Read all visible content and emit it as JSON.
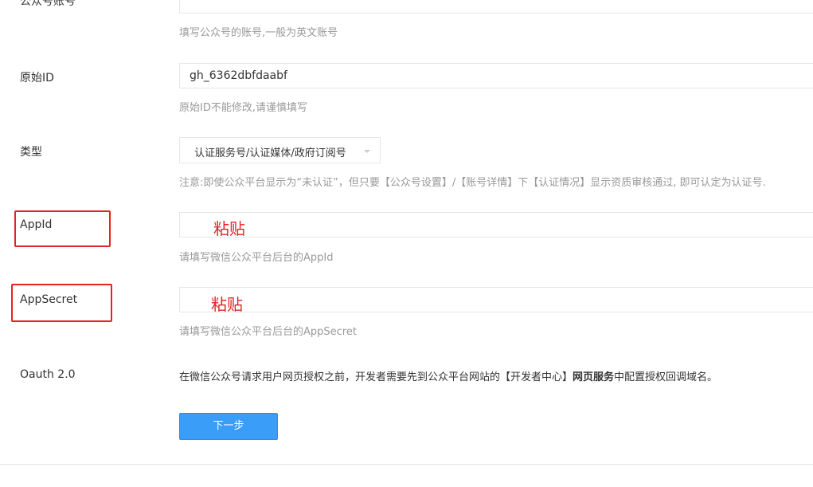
{
  "form": {
    "account": {
      "label": "公众号账号",
      "value": "",
      "help": "填写公众号的账号,一般为英文账号"
    },
    "original_id": {
      "label": "原始ID",
      "value": "gh_6362dbfdaabf",
      "help": "原始ID不能修改,请谨慎填写"
    },
    "type": {
      "label": "类型",
      "selected": "认证服务号/认证媒体/政府订阅号",
      "help": "注意:即使公众平台显示为“未认证”，但只要【公众号设置】/【账号详情】下【认证情况】显示资质审核通过, 即可认定为认证号."
    },
    "app_id": {
      "label": "AppId",
      "value": "",
      "help": "请填写微信公众平台后台的AppId"
    },
    "app_secret": {
      "label": "AppSecret",
      "value": "",
      "help": "请填写微信公众平台后台的AppSecret"
    },
    "oauth": {
      "label": "Oauth 2.0",
      "text_before": "在微信公众号请求用户网页授权之前，开发者需要先到公众平台网站的【开发者中心】",
      "text_bold": "网页服务",
      "text_after": "中配置授权回调域名。"
    },
    "next_button_label": "下一步"
  },
  "annotations": {
    "paste_appid": "粘贴",
    "paste_appsecret": "粘贴",
    "color": "#e32424"
  },
  "colors": {
    "primary_button": "#3a9df7",
    "help_text": "#999999",
    "border": "#e6e6e6"
  }
}
